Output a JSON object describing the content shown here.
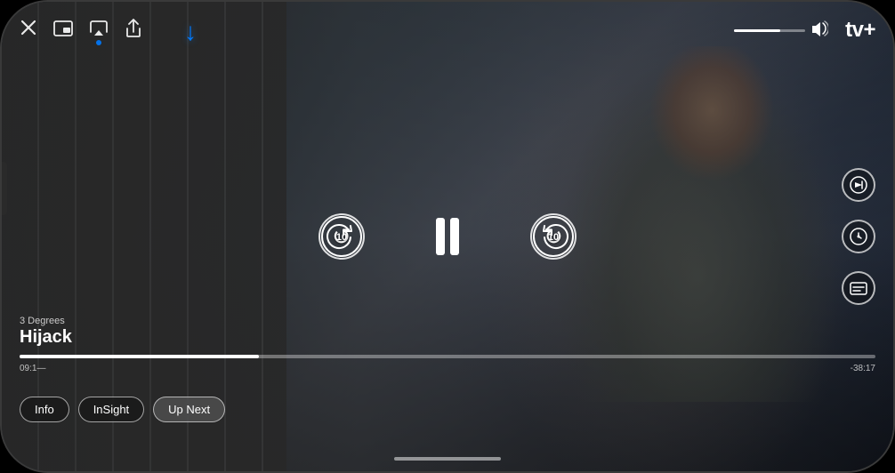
{
  "phone": {
    "show": {
      "subtitle": "3 Degrees",
      "title": "Hijack"
    },
    "logo": {
      "text": "tv+",
      "apple_symbol": ""
    },
    "controls": {
      "rewind_label": "10",
      "forward_label": "10",
      "pause_label": "pause"
    },
    "time": {
      "elapsed": "09:1—",
      "remaining": "-38:17"
    },
    "tabs": [
      {
        "label": "Info",
        "active": false
      },
      {
        "label": "InSight",
        "active": false
      },
      {
        "label": "Up Next",
        "active": false
      }
    ],
    "side_controls": [
      {
        "icon": "⏱",
        "name": "playback-speed"
      },
      {
        "icon": "🎙",
        "name": "audio"
      },
      {
        "icon": "💬",
        "name": "subtitles"
      }
    ],
    "top_controls": [
      {
        "icon": "✕",
        "name": "close"
      },
      {
        "icon": "⊡",
        "name": "picture-in-picture"
      },
      {
        "icon": "⊡▸",
        "name": "airplay"
      },
      {
        "icon": "↑",
        "name": "share"
      }
    ],
    "volume": {
      "level": 65
    },
    "blue_arrow": "↓"
  }
}
